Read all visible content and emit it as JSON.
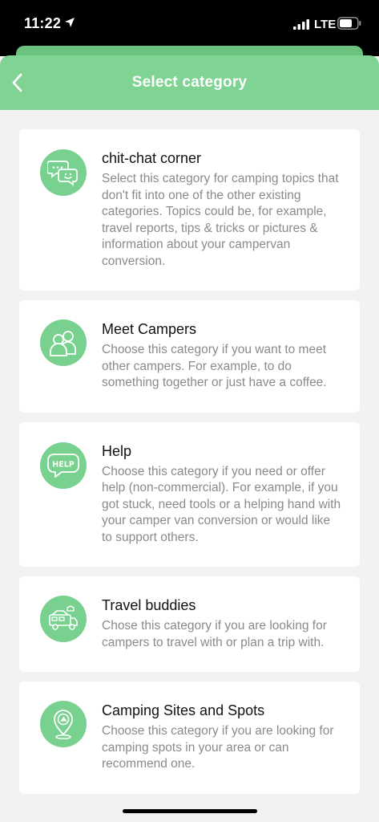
{
  "status_bar": {
    "time": "11:22",
    "network": "LTE"
  },
  "header": {
    "title": "Select category"
  },
  "categories": [
    {
      "title": "chit-chat corner",
      "description": "Select this category for camping topics that don't fit into one of the other existing categories. Topics could be, for example, travel reports, tips & tricks or pictures & information about your campervan conversion.",
      "icon": "chat-bubbles-icon"
    },
    {
      "title": "Meet Campers",
      "description": "Choose this category if you want to meet other campers. For example, to do something together or just have a coffee.",
      "icon": "people-icon"
    },
    {
      "title": "Help",
      "description": "Choose this category if you need or offer help (non-commercial). For example, if you got stuck, need tools or a helping hand with your camper van conversion or would like to support others.",
      "icon": "help-bubble-icon"
    },
    {
      "title": "Travel buddies",
      "description": "Chose this category if you are looking for campers to travel with or plan a trip with.",
      "icon": "camper-van-icon"
    },
    {
      "title": "Camping Sites and Spots",
      "description": "Choose this category if you are looking for camping spots in your area or can recommend one.",
      "icon": "location-pin-icon"
    }
  ],
  "colors": {
    "accent": "#7fd494",
    "icon_bg": "#79d18f",
    "background": "#f2f2f2"
  }
}
